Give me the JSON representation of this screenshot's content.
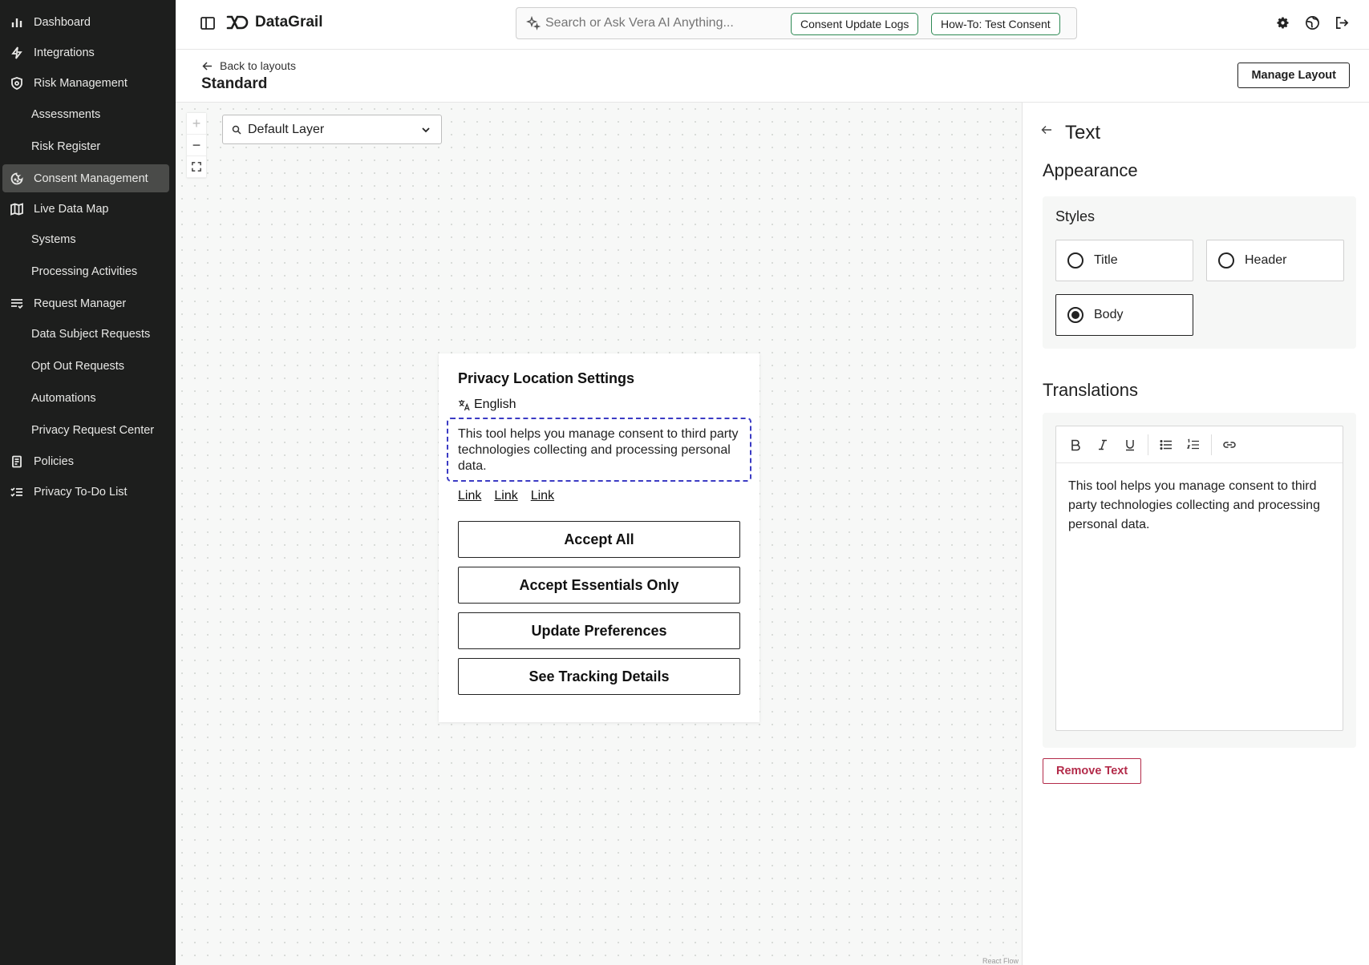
{
  "sidebar": {
    "items": [
      {
        "label": "Dashboard",
        "icon": "bar-chart-icon"
      },
      {
        "label": "Integrations",
        "icon": "lightning-icon"
      },
      {
        "label": "Risk Management",
        "icon": "shield-icon"
      },
      {
        "label": "Assessments"
      },
      {
        "label": "Risk Register"
      },
      {
        "label": "Consent Management",
        "icon": "cookie-icon",
        "active": true
      },
      {
        "label": "Live Data Map",
        "icon": "map-icon"
      },
      {
        "label": "Systems"
      },
      {
        "label": "Processing Activities"
      },
      {
        "label": "Request Manager",
        "icon": "list-check-icon"
      },
      {
        "label": "Data Subject Requests"
      },
      {
        "label": "Opt Out Requests"
      },
      {
        "label": "Automations"
      },
      {
        "label": "Privacy Request Center"
      },
      {
        "label": "Policies",
        "icon": "document-icon"
      },
      {
        "label": "Privacy To-Do List",
        "icon": "checklist-icon"
      }
    ]
  },
  "header": {
    "logo": "DataGrail",
    "search_placeholder": "Search or Ask Vera AI Anything...",
    "chip_logs": "Consent Update Logs",
    "chip_howto": "How-To: Test Consent"
  },
  "subheader": {
    "back": "Back to layouts",
    "title": "Standard",
    "manage": "Manage Layout"
  },
  "canvas": {
    "layer": "Default Layer",
    "attribution": "React Flow",
    "modal": {
      "title": "Privacy Location Settings",
      "language": "English",
      "body": "This tool helps you manage consent to third party technologies collecting and processing personal data.",
      "links": [
        "Link",
        "Link",
        "Link"
      ],
      "buttons": [
        "Accept All",
        "Accept Essentials Only",
        "Update Preferences",
        "See Tracking Details"
      ]
    }
  },
  "panel": {
    "title": "Text",
    "appearance": "Appearance",
    "styles_label": "Styles",
    "options": {
      "title": "Title",
      "header": "Header",
      "body": "Body"
    },
    "selected": "Body",
    "translations": "Translations",
    "editor_text": "This tool helps you manage consent to third party technologies collecting and processing personal data.",
    "remove": "Remove Text"
  },
  "colors": {
    "sidebar_bg": "#1d1e1d",
    "active_bg": "#4a4b49",
    "chip_border": "#2e8a55",
    "selection_border": "#3b3bc4",
    "danger": "#b32b4a"
  }
}
